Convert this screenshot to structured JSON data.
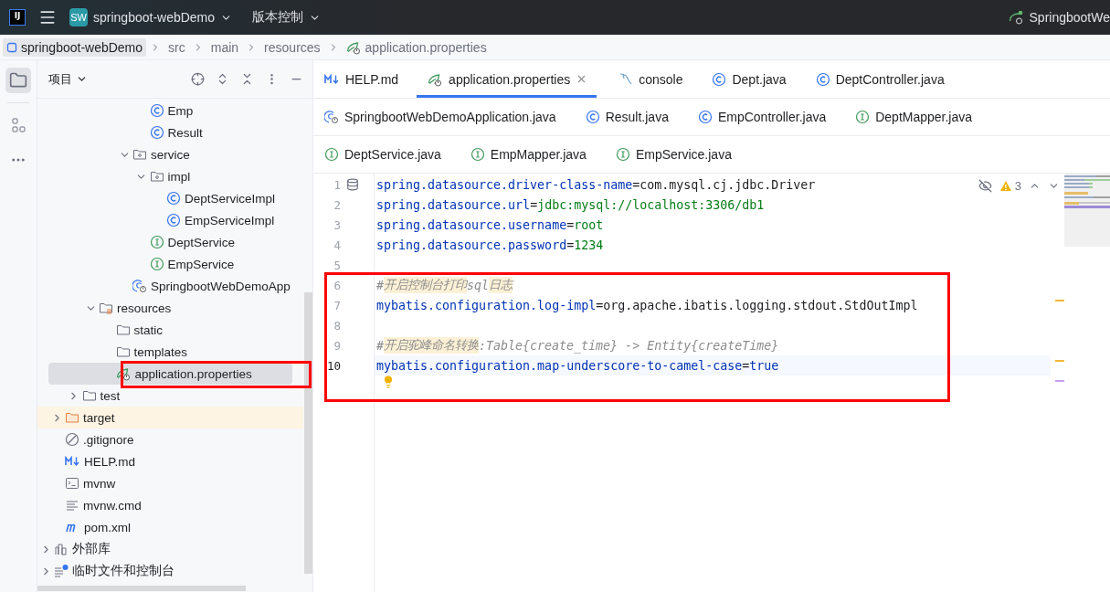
{
  "title_bar": {
    "logo": "IJ",
    "project_badge": "SW",
    "project_name": "springboot-webDemo",
    "vcs_menu": "版本控制",
    "run_config": "SpringbootWe"
  },
  "breadcrumbs": [
    {
      "label": "springboot-webDemo",
      "kind": "module",
      "selected": true
    },
    {
      "label": "src",
      "selected": false
    },
    {
      "label": "main",
      "selected": false
    },
    {
      "label": "resources",
      "selected": false
    },
    {
      "label": "application.properties",
      "kind": "spring-config",
      "selected": false
    }
  ],
  "project_panel": {
    "title": "项目",
    "tree": [
      {
        "children": [
          {
            "children": [
              {
                "children": [
                  {
                    "children": [
                      {
                        "children": [
                          {
                            "children": [
                              {
                                "label": "Emp",
                                "kind": "class",
                                "selected": false
                              },
                              {
                                "label": "Result",
                                "kind": "class",
                                "selected": false
                              }
                            ]
                          },
                          {
                            "label": "service",
                            "kind": "package",
                            "expanded": true,
                            "selected": false,
                            "children": [
                              {
                                "label": "impl",
                                "kind": "package",
                                "expanded": true,
                                "selected": false,
                                "children": [
                                  {
                                    "label": "DeptServiceImpl",
                                    "kind": "class",
                                    "selected": false
                                  },
                                  {
                                    "label": "EmpServiceImpl",
                                    "kind": "class",
                                    "selected": false
                                  }
                                ]
                              },
                              {
                                "label": "DeptService",
                                "kind": "interface",
                                "selected": false
                              },
                              {
                                "label": "EmpService",
                                "kind": "interface",
                                "selected": false
                              }
                            ]
                          },
                          {
                            "label": "SpringbootWebDemoApp",
                            "kind": "spring-class",
                            "selected": false
                          }
                        ]
                      }
                    ]
                  },
                  {
                    "label": "resources",
                    "kind": "resources",
                    "expanded": true,
                    "selected": false,
                    "children": [
                      {
                        "label": "static",
                        "kind": "folder",
                        "selected": false
                      },
                      {
                        "label": "templates",
                        "kind": "folder",
                        "selected": false
                      },
                      {
                        "label": "application.properties",
                        "kind": "spring-config",
                        "selected": true
                      }
                    ]
                  }
                ]
              },
              {
                "label": "test",
                "kind": "folder",
                "expanded": false,
                "selected": false
              }
            ]
          },
          {
            "label": "target",
            "kind": "excluded-folder",
            "expanded": false,
            "excluded": true,
            "selected": false
          },
          {
            "label": ".gitignore",
            "kind": "ignore",
            "selected": false
          },
          {
            "label": "HELP.md",
            "kind": "markdown",
            "selected": false
          },
          {
            "label": "mvnw",
            "kind": "terminal",
            "selected": false
          },
          {
            "label": "mvnw.cmd",
            "kind": "text",
            "selected": false
          },
          {
            "label": "pom.xml",
            "kind": "maven",
            "selected": false
          }
        ]
      },
      {
        "label": "外部库",
        "kind": "library",
        "expanded": false,
        "selected": false
      },
      {
        "label": "临时文件和控制台",
        "kind": "scratch",
        "expanded": false,
        "selected": false
      }
    ]
  },
  "editor_tabs": [
    [
      {
        "label": "HELP.md",
        "kind": "markdown",
        "selected": false
      },
      {
        "label": "application.properties",
        "kind": "spring-config",
        "selected": true
      },
      {
        "label": "console",
        "kind": "console",
        "selected": false
      },
      {
        "label": "Dept.java",
        "kind": "class",
        "selected": false
      },
      {
        "label": "DeptController.java",
        "kind": "class",
        "selected": false
      }
    ],
    [
      {
        "label": "SpringbootWebDemoApplication.java",
        "kind": "spring-class",
        "selected": false
      },
      {
        "label": "Result.java",
        "kind": "class",
        "selected": false
      },
      {
        "label": "EmpController.java",
        "kind": "class",
        "selected": false
      },
      {
        "label": "DeptMapper.java",
        "kind": "interface",
        "selected": false
      }
    ],
    [
      {
        "label": "DeptService.java",
        "kind": "interface",
        "selected": false
      },
      {
        "label": "EmpMapper.java",
        "kind": "interface",
        "selected": false
      },
      {
        "label": "EmpService.java",
        "kind": "interface",
        "selected": false
      }
    ]
  ],
  "editor": {
    "warnings": "3",
    "lines": [
      {
        "number": "1",
        "current": false,
        "segments": [
          {
            "kind": "key",
            "text": "spring.datasource.driver-class-name"
          },
          {
            "kind": "op",
            "text": "="
          },
          {
            "kind": "value",
            "text": "com.mysql.cj.jdbc.Driver"
          }
        ]
      },
      {
        "number": "2",
        "current": false,
        "segments": [
          {
            "kind": "key",
            "text": "spring.datasource.url"
          },
          {
            "kind": "op",
            "text": "="
          },
          {
            "kind": "string",
            "text": "jdbc:mysql://localhost:3306/db1"
          }
        ]
      },
      {
        "number": "3",
        "current": false,
        "segments": [
          {
            "kind": "key",
            "text": "spring.datasource.username"
          },
          {
            "kind": "op",
            "text": "="
          },
          {
            "kind": "string",
            "text": "root"
          }
        ]
      },
      {
        "number": "4",
        "current": false,
        "segments": [
          {
            "kind": "key",
            "text": "spring.datasource.password"
          },
          {
            "kind": "op",
            "text": "="
          },
          {
            "kind": "string",
            "text": "1234"
          }
        ]
      },
      {
        "number": "5",
        "current": false
      },
      {
        "number": "6",
        "current": false,
        "segments": [
          {
            "kind": "comment",
            "text": "#"
          },
          {
            "kind": "comment-marked",
            "text": "开启控制台打印"
          },
          {
            "kind": "comment",
            "text": "sql"
          },
          {
            "kind": "comment-marked",
            "text": "日志"
          }
        ]
      },
      {
        "number": "7",
        "current": false,
        "segments": [
          {
            "kind": "key",
            "text": "mybatis.configuration.log-impl"
          },
          {
            "kind": "op",
            "text": "="
          },
          {
            "kind": "value",
            "text": "org.apache.ibatis.logging.stdout.StdOutImpl"
          }
        ]
      },
      {
        "number": "8",
        "current": false
      },
      {
        "number": "9",
        "current": false,
        "segments": [
          {
            "kind": "comment",
            "text": "#"
          },
          {
            "kind": "comment-marked",
            "text": "开启驼峰命名转换"
          },
          {
            "kind": "comment",
            "text": ":Table{create_time} -> Entity{createTime}"
          }
        ]
      },
      {
        "number": "10",
        "current": true,
        "segments": [
          {
            "kind": "key",
            "text": "mybatis.configuration.map-underscore-to-camel-case"
          },
          {
            "kind": "op",
            "text": "="
          },
          {
            "kind": "keyword",
            "text": "true"
          }
        ]
      }
    ]
  }
}
